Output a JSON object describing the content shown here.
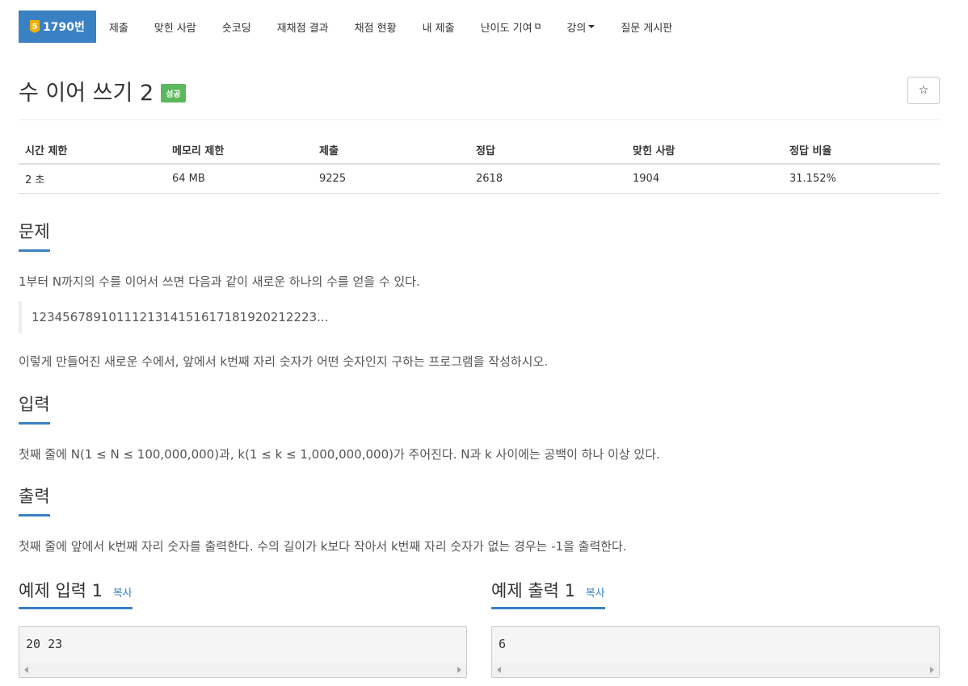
{
  "nav": {
    "tier": "5",
    "problem_no": "1790번",
    "items": [
      "제출",
      "맞힌 사람",
      "숏코딩",
      "재채점 결과",
      "채점 현황",
      "내 제출",
      "난이도 기여",
      "강의",
      "질문 게시판"
    ]
  },
  "problem": {
    "title": "수 이어 쓰기 2",
    "status_label": "성공",
    "star": "☆"
  },
  "info": {
    "headers": [
      "시간 제한",
      "메모리 제한",
      "제출",
      "정답",
      "맞힌 사람",
      "정답 비율"
    ],
    "values": [
      "2 초",
      "64 MB",
      "9225",
      "2618",
      "1904",
      "31.152%"
    ]
  },
  "sections": {
    "problem": {
      "title": "문제",
      "line1": "1부터 N까지의 수를 이어서 쓰면 다음과 같이 새로운 하나의 수를 얻을 수 있다.",
      "quote": "1234567891011121314151617181920212223...",
      "line2": "이렇게 만들어진 새로운 수에서, 앞에서 k번째 자리 숫자가 어떤 숫자인지 구하는 프로그램을 작성하시오."
    },
    "input": {
      "title": "입력",
      "text": "첫째 줄에 N(1 ≤ N ≤ 100,000,000)과, k(1 ≤ k ≤ 1,000,000,000)가 주어진다. N과 k 사이에는 공백이 하나 이상 있다."
    },
    "output": {
      "title": "출력",
      "text": "첫째 줄에 앞에서 k번째 자리 숫자를 출력한다. 수의 길이가 k보다 작아서 k번째 자리 숫자가 없는 경우는 -1을 출력한다."
    }
  },
  "samples": {
    "input": {
      "title": "예제 입력 1",
      "copy": "복사",
      "content": "20 23"
    },
    "output": {
      "title": "예제 출력 1",
      "copy": "복사",
      "content": "6"
    }
  },
  "colors": {
    "accent": "#3a81c4",
    "success": "#5cb85c",
    "tier": "#f0b000"
  }
}
